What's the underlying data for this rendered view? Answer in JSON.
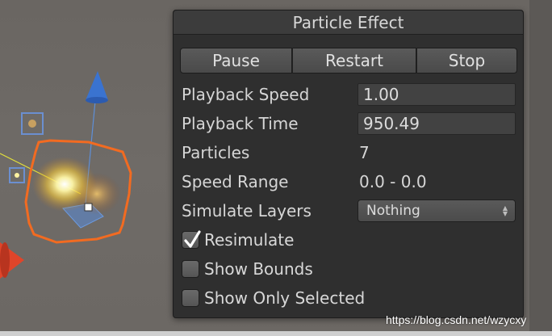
{
  "panel": {
    "title": "Particle Effect",
    "buttons": {
      "pause": "Pause",
      "restart": "Restart",
      "stop": "Stop"
    },
    "playback_speed": {
      "label": "Playback Speed",
      "value": "1.00"
    },
    "playback_time": {
      "label": "Playback Time",
      "value": "950.49"
    },
    "particles": {
      "label": "Particles",
      "value": "7"
    },
    "speed_range": {
      "label": "Speed Range",
      "value": "0.0 - 0.0"
    },
    "simulate_layers": {
      "label": "Simulate Layers",
      "value": "Nothing"
    },
    "resimulate": {
      "label": "Resimulate",
      "checked": true
    },
    "show_bounds": {
      "label": "Show Bounds",
      "checked": false
    },
    "show_only_selected": {
      "label": "Show Only Selected",
      "checked": false
    }
  },
  "watermark": "https://blog.csdn.net/wzycxy",
  "colors": {
    "panel_bg": "#2f2f2f",
    "header_bg": "#3c3c3c",
    "selection_orange": "#f26b21",
    "gizmo_blue": "#3a7bd5",
    "gizmo_red": "#e0452a"
  }
}
